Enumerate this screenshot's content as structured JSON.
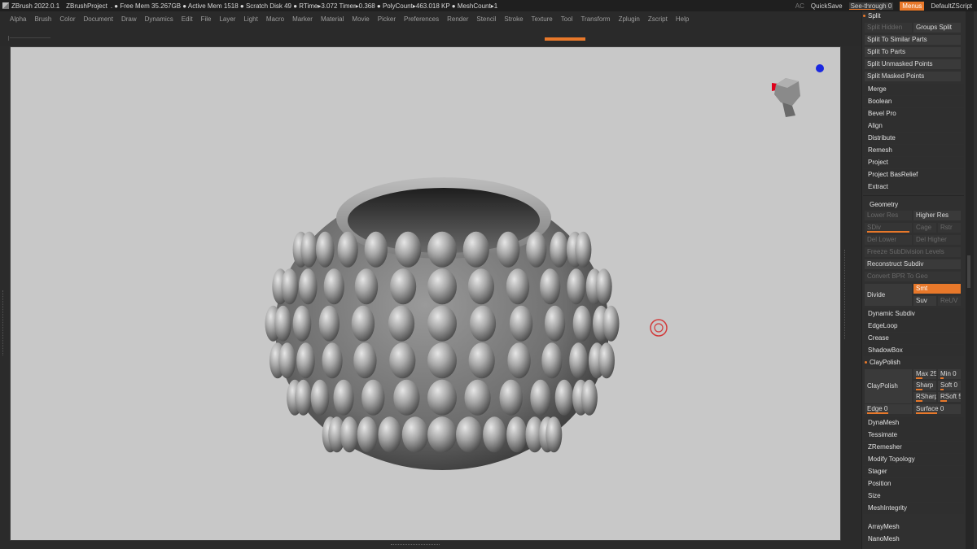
{
  "titlebar": {
    "app": "ZBrush 2022.0.1",
    "project": "ZBrushProject",
    "stats": ". ● Free Mem 35.267GB ● Active Mem 1518 ● Scratch Disk 49 ● RTime▸3.072 Timer▸0.368 ● PolyCount▸463.018 KP ● MeshCount▸1",
    "ac": "AC",
    "quicksave": "QuickSave",
    "seethrough": "See-through  0",
    "menus": "Menus",
    "script": "DefaultZScript"
  },
  "menubar": [
    "Alpha",
    "Brush",
    "Color",
    "Document",
    "Draw",
    "Dynamics",
    "Edit",
    "File",
    "Layer",
    "Light",
    "Macro",
    "Marker",
    "Material",
    "Movie",
    "Picker",
    "Preferences",
    "Render",
    "Stencil",
    "Stroke",
    "Texture",
    "Tool",
    "Transform",
    "Zplugin",
    "Zscript",
    "Help"
  ],
  "split": {
    "title": "Split",
    "split_hidden": "Split Hidden",
    "groups_split": "Groups Split",
    "items": [
      "Split To Similar Parts",
      "Split To Parts",
      "Split Unmasked Points",
      "Split Masked Points"
    ]
  },
  "subtool_actions": [
    "Merge",
    "Boolean",
    "Bevel Pro",
    "Align",
    "Distribute",
    "Remesh",
    "Project",
    "Project BasRelief",
    "Extract"
  ],
  "geometry": {
    "title": "Geometry",
    "lower_res": "Lower Res",
    "higher_res": "Higher Res",
    "sdiv": "SDiv",
    "cage": "Cage",
    "rstr": "Rstr",
    "del_lower": "Del Lower",
    "del_higher": "Del Higher",
    "freeze": "Freeze SubDivision Levels",
    "reconstruct": "Reconstruct Subdiv",
    "convert_bpr": "Convert BPR To Geo",
    "divide": "Divide",
    "smt": "Smt",
    "suv": "Suv",
    "reuv": "ReUV"
  },
  "geometry_items": [
    "Dynamic Subdiv",
    "EdgeLoop",
    "Crease",
    "ShadowBox"
  ],
  "claypolish": {
    "title": "ClayPolish",
    "button": "ClayPolish",
    "max_label": "Max",
    "max": "25",
    "min_label": "Min",
    "min": "0",
    "sharp_label": "Sharp",
    "sharp": "",
    "soft_label": "Soft",
    "soft": "0",
    "rsharp_label": "RSharp",
    "rsharp": "",
    "rsoft_label": "RSoft",
    "rsoft": "5",
    "edge_label": "Edge",
    "edge": "0",
    "surface_label": "Surface",
    "surface": "0"
  },
  "more_items": [
    "DynaMesh",
    "Tessimate",
    "ZRemesher",
    "Modify Topology",
    "Stager",
    "Position",
    "Size",
    "MeshIntegrity"
  ],
  "bottom_items": [
    "ArrayMesh",
    "NanoMesh"
  ],
  "colors": {
    "accent": "#e8782a",
    "canvas": "#c8c8c8",
    "panel": "#303030"
  },
  "icons": [
    "gizmo-icon",
    "head-navigation-icon",
    "cursor-ring-icon",
    "app-logo-icon"
  ]
}
